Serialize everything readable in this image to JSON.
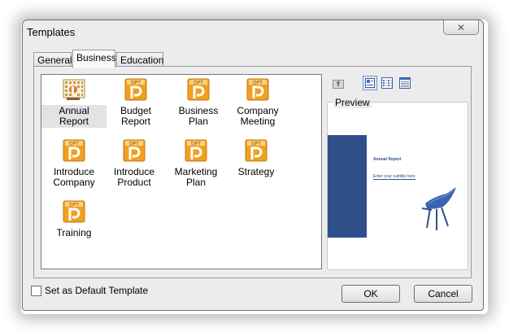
{
  "window": {
    "title": "Templates"
  },
  "tabs": [
    {
      "label": "General",
      "active": false
    },
    {
      "label": "Business",
      "active": true
    },
    {
      "label": "Education",
      "active": false
    }
  ],
  "templates": [
    {
      "label": "Annual Report",
      "icon": "annual-report-icon",
      "selected": true
    },
    {
      "label": "Budget Report",
      "icon": "dpt-presentation-icon",
      "selected": false
    },
    {
      "label": "Business Plan",
      "icon": "dpt-presentation-icon",
      "selected": false
    },
    {
      "label": "Company Meeting",
      "icon": "dpt-presentation-icon",
      "selected": false
    },
    {
      "label": "Introduce Company",
      "icon": "dpt-presentation-icon",
      "selected": false
    },
    {
      "label": "Introduce Product",
      "icon": "dpt-presentation-icon",
      "selected": false
    },
    {
      "label": "Marketing Plan",
      "icon": "dpt-presentation-icon",
      "selected": false
    },
    {
      "label": "Strategy",
      "icon": "dpt-presentation-icon",
      "selected": false
    },
    {
      "label": "Training",
      "icon": "dpt-presentation-icon",
      "selected": false
    }
  ],
  "icon_text": "DPT",
  "view_toolbar": [
    "up-one-level-icon",
    "large-icons-view-icon",
    "list-view-icon",
    "details-view-icon"
  ],
  "preview": {
    "label": "Preview",
    "slide_title": "Annual Report",
    "slide_subtitle": "Enter your subtitle here"
  },
  "footer": {
    "default_checkbox_label": "Set as Default Template",
    "default_checked": false,
    "ok_label": "OK",
    "cancel_label": "Cancel"
  },
  "colors": {
    "icon_orange": "#f0a020",
    "preview_blue": "#2e4f8a"
  }
}
